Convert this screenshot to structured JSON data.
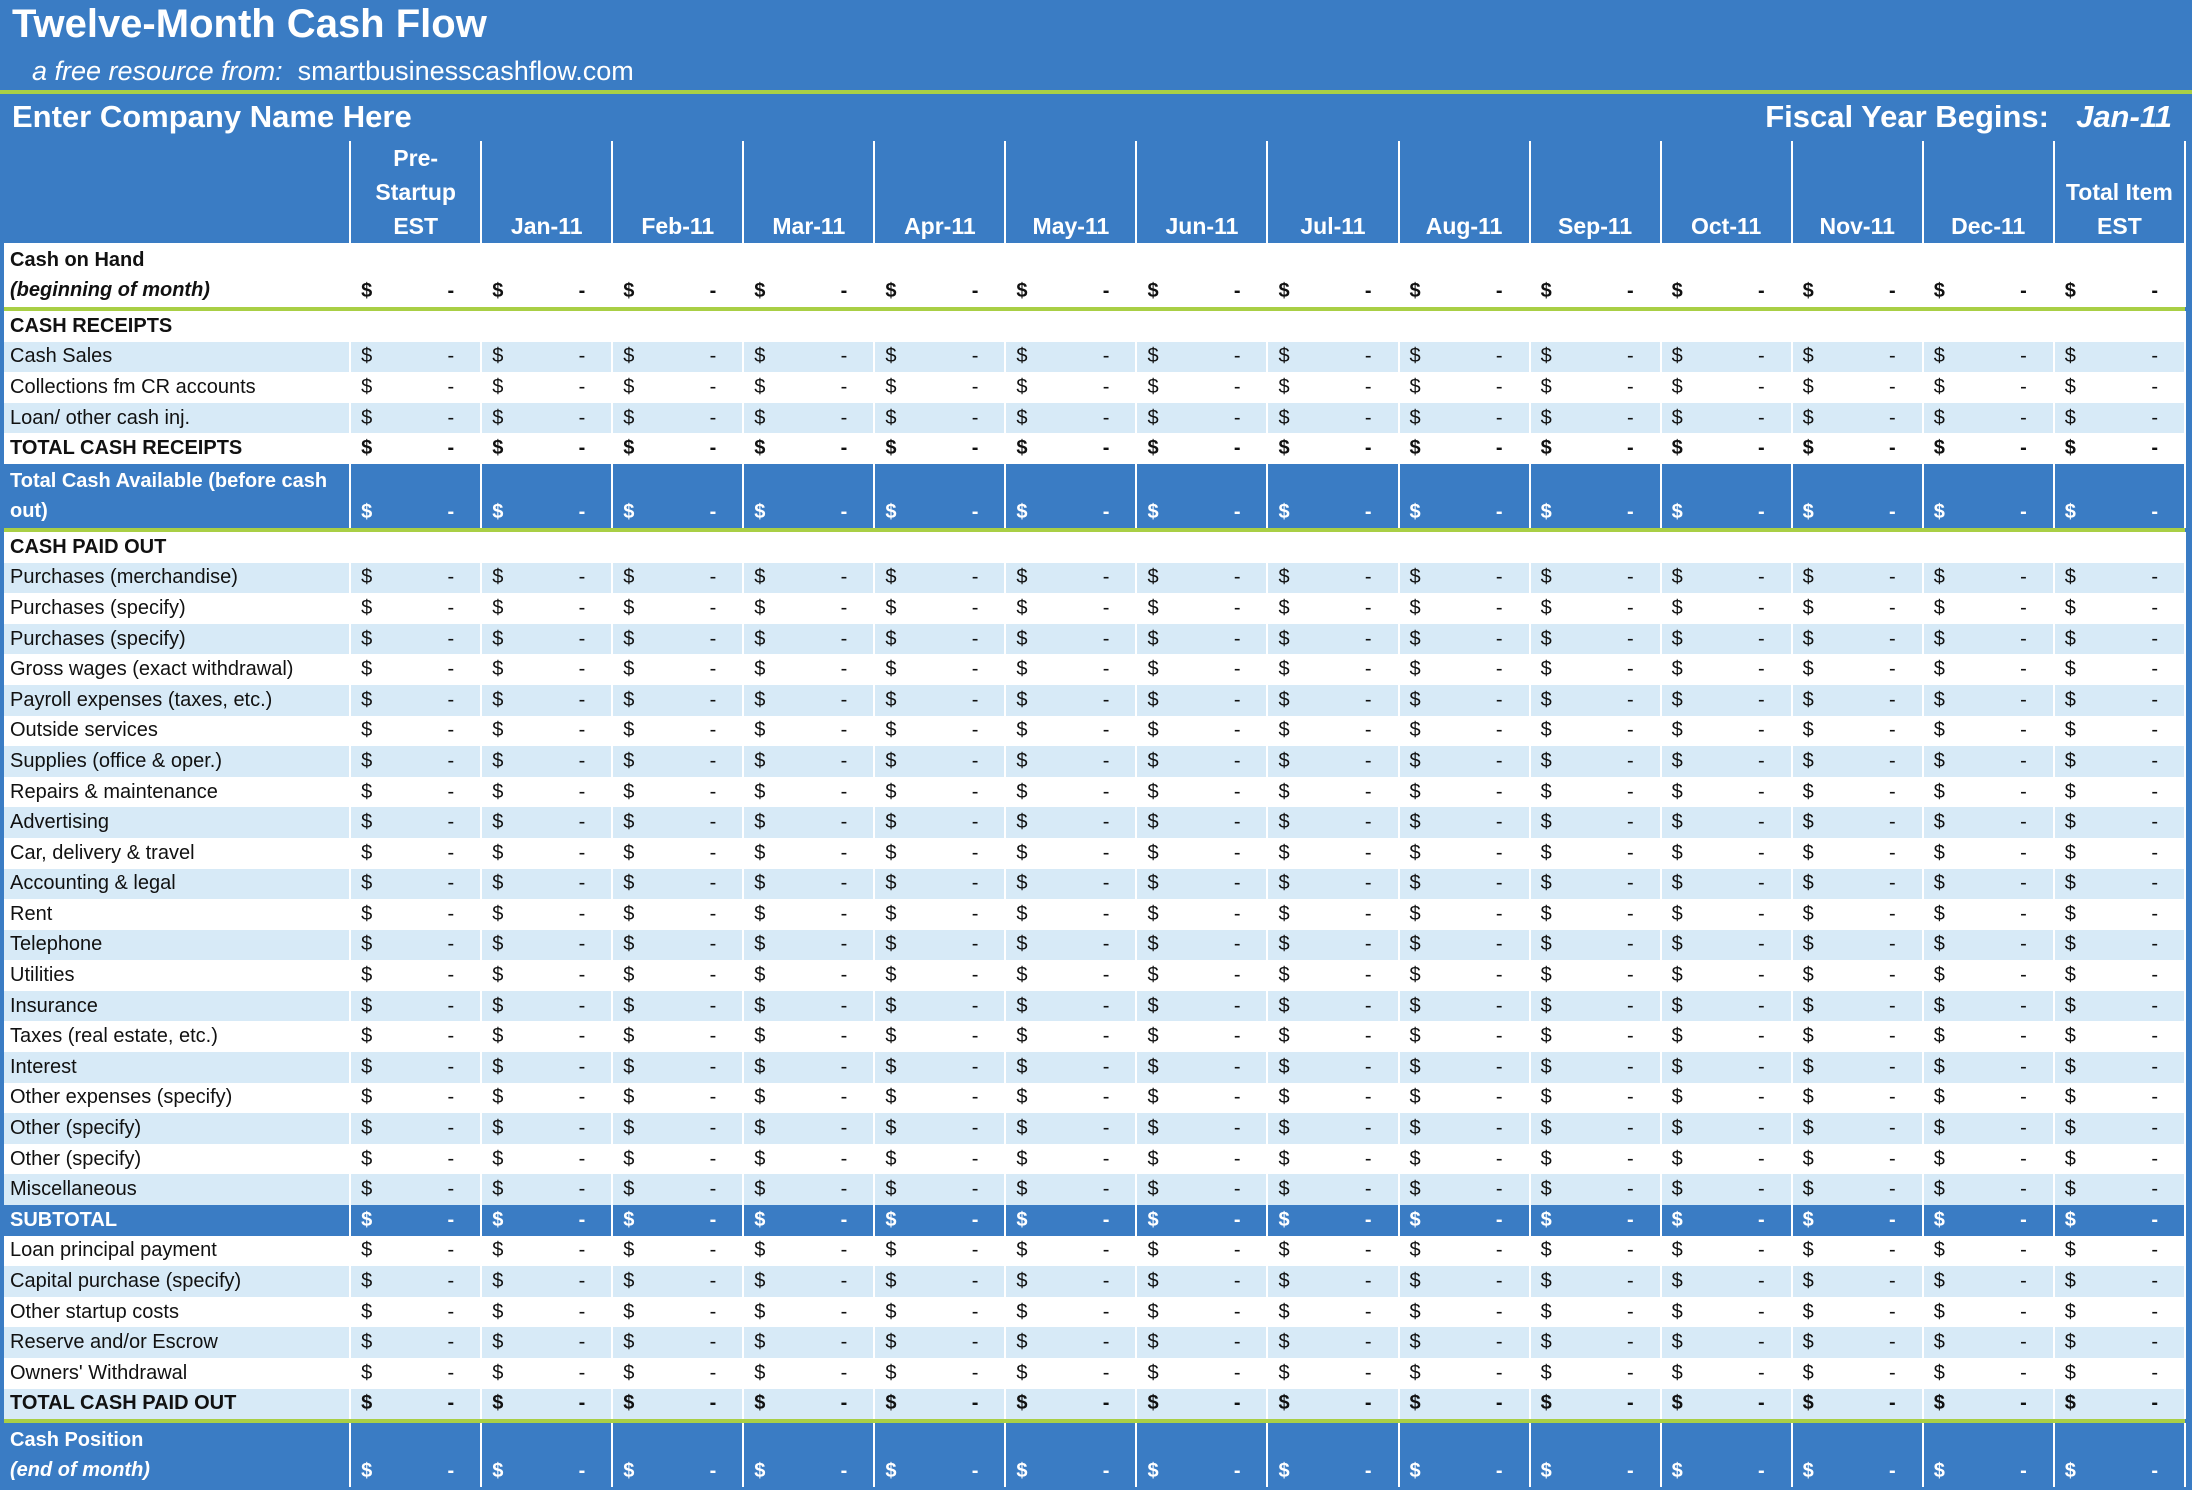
{
  "header": {
    "title": "Twelve-Month Cash Flow",
    "subtitle_prefix": "a free resource from:",
    "subtitle_site": "smartbusinesscashflow.com",
    "company": "Enter Company Name Here",
    "fiscal_label": "Fiscal Year Begins:",
    "fiscal_value": "Jan-11"
  },
  "columns": [
    [
      "Pre-",
      "Startup",
      "EST"
    ],
    [
      "Jan-11"
    ],
    [
      "Feb-11"
    ],
    [
      "Mar-11"
    ],
    [
      "Apr-11"
    ],
    [
      "May-11"
    ],
    [
      "Jun-11"
    ],
    [
      "Jul-11"
    ],
    [
      "Aug-11"
    ],
    [
      "Sep-11"
    ],
    [
      "Oct-11"
    ],
    [
      "Nov-11"
    ],
    [
      "Dec-11"
    ],
    [
      "Total Item",
      "EST"
    ]
  ],
  "cell": {
    "currency": "$",
    "value": "-"
  },
  "rows": [
    {
      "type": "white2",
      "bold": true,
      "label1": "Cash on Hand",
      "label2": "(beginning of month)",
      "values": true
    },
    {
      "type": "sep"
    },
    {
      "type": "white",
      "bold": true,
      "label": "CASH RECEIPTS",
      "values": false
    },
    {
      "type": "light",
      "label": "Cash Sales",
      "values": true
    },
    {
      "type": "white",
      "label": "Collections fm CR accounts",
      "values": true
    },
    {
      "type": "light",
      "label": "Loan/ other cash inj.",
      "values": true
    },
    {
      "type": "white",
      "bold": true,
      "label": "TOTAL CASH RECEIPTS",
      "values": true
    },
    {
      "type": "blue2",
      "bold": true,
      "label1": "Total Cash Available (before cash",
      "label2": "out)",
      "values": true
    },
    {
      "type": "sep"
    },
    {
      "type": "white",
      "bold": true,
      "label": "CASH PAID OUT",
      "values": false
    },
    {
      "type": "light",
      "label": "Purchases (merchandise)",
      "values": true
    },
    {
      "type": "white",
      "label": "Purchases (specify)",
      "values": true
    },
    {
      "type": "light",
      "label": "Purchases (specify)",
      "values": true
    },
    {
      "type": "white",
      "label": "Gross wages (exact withdrawal)",
      "values": true
    },
    {
      "type": "light",
      "label": "Payroll expenses (taxes, etc.)",
      "values": true
    },
    {
      "type": "white",
      "label": "Outside services",
      "values": true
    },
    {
      "type": "light",
      "label": "Supplies (office & oper.)",
      "values": true
    },
    {
      "type": "white",
      "label": "Repairs & maintenance",
      "values": true
    },
    {
      "type": "light",
      "label": "Advertising",
      "values": true
    },
    {
      "type": "white",
      "label": "Car, delivery & travel",
      "values": true
    },
    {
      "type": "light",
      "label": "Accounting & legal",
      "values": true
    },
    {
      "type": "white",
      "label": "Rent",
      "values": true
    },
    {
      "type": "light",
      "label": "Telephone",
      "values": true
    },
    {
      "type": "white",
      "label": "Utilities",
      "values": true
    },
    {
      "type": "light",
      "label": "Insurance",
      "values": true
    },
    {
      "type": "white",
      "label": "Taxes (real estate, etc.)",
      "values": true
    },
    {
      "type": "light",
      "label": "Interest",
      "values": true
    },
    {
      "type": "white",
      "label": "Other expenses (specify)",
      "values": true
    },
    {
      "type": "light",
      "label": "Other (specify)",
      "values": true
    },
    {
      "type": "white",
      "label": "Other (specify)",
      "values": true
    },
    {
      "type": "light",
      "label": "Miscellaneous",
      "values": true
    },
    {
      "type": "blue",
      "bold": true,
      "label": "SUBTOTAL",
      "values": true
    },
    {
      "type": "white",
      "label": "Loan principal payment",
      "values": true
    },
    {
      "type": "light",
      "label": "Capital purchase (specify)",
      "values": true
    },
    {
      "type": "white",
      "label": "Other startup costs",
      "values": true
    },
    {
      "type": "light",
      "label": "Reserve and/or Escrow",
      "values": true
    },
    {
      "type": "white",
      "label": "Owners' Withdrawal",
      "values": true
    },
    {
      "type": "light",
      "bold": true,
      "label": "TOTAL CASH PAID OUT",
      "values": true
    },
    {
      "type": "sep"
    },
    {
      "type": "blue2",
      "bold": true,
      "label1": "Cash Position",
      "label2": "(end of month)",
      "values": true
    }
  ],
  "colors": {
    "header_blue": "#3a7cc4",
    "light_row": "#d7eaf7",
    "accent_green": "#a9cf45"
  }
}
